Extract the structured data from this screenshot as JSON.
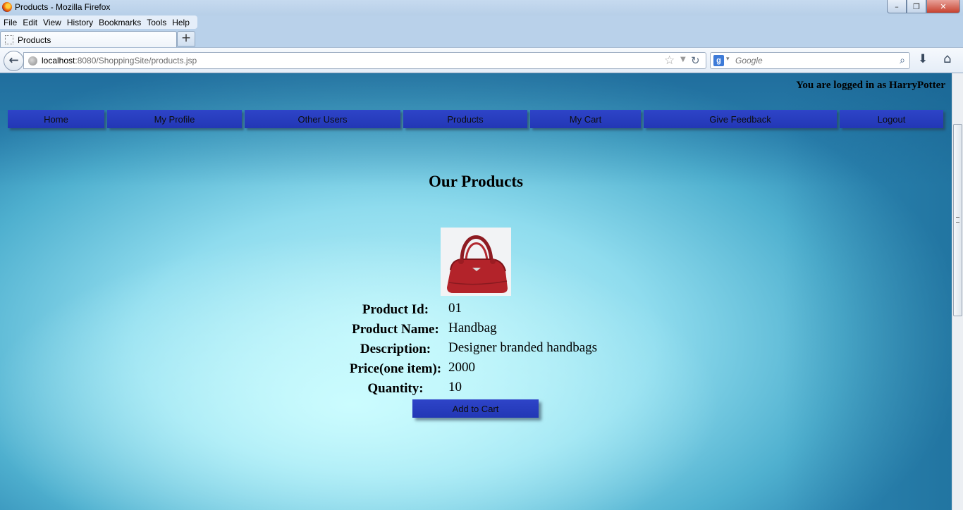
{
  "window": {
    "title": "Products - Mozilla Firefox",
    "minimize": "–",
    "maximize": "❐",
    "close": "✕"
  },
  "menu": [
    "File",
    "Edit",
    "View",
    "History",
    "Bookmarks",
    "Tools",
    "Help"
  ],
  "tab": {
    "label": "Products",
    "new_tab": "+"
  },
  "toolbar": {
    "back": "←",
    "url_host": "localhost",
    "url_rest": ":8080/ShoppingSite/products.jsp",
    "bookmark_star": "☆",
    "dropdown": "▼",
    "reload": "↻",
    "search_engine": "g",
    "search_dropdown": "▾",
    "search_placeholder": "Google",
    "magnifier": "⌕",
    "downloads": "⬇",
    "home": "⌂"
  },
  "page": {
    "login_status": "You are logged in as HarryPotter",
    "nav": [
      "Home",
      "My Profile",
      "Other Users",
      "Products",
      "My Cart",
      "Give Feedback",
      "Logout"
    ],
    "heading": "Our Products",
    "product": {
      "image_alt": "red-handbag",
      "fields": [
        {
          "label": "Product Id:",
          "value": "01"
        },
        {
          "label": "Product Name:",
          "value": "Handbag"
        },
        {
          "label": "Description:",
          "value": "Designer branded handbags"
        },
        {
          "label": "Price(one item):",
          "value": "2000"
        },
        {
          "label": "Quantity:",
          "value": "10"
        }
      ],
      "button": "Add to Cart"
    }
  },
  "colors": {
    "button_blue": "#2a3fc2",
    "bg_light": "#c1f4fa",
    "bg_dark": "#2d87b3",
    "handbag_red": "#b3232a"
  }
}
